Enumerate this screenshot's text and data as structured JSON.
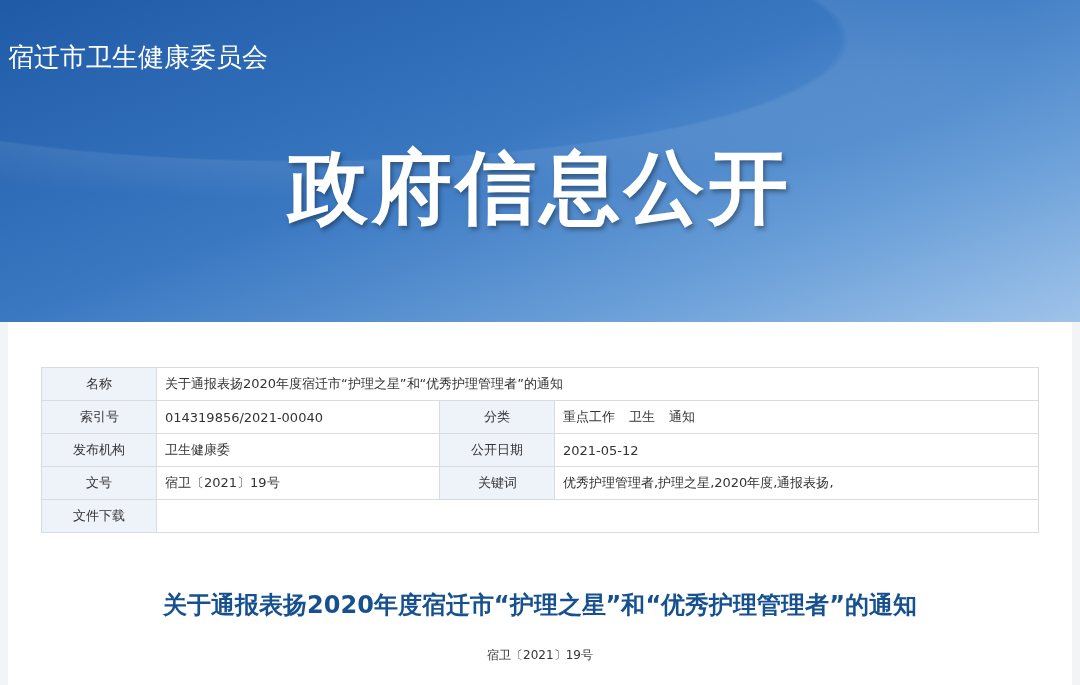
{
  "site_name": "宿迁市卫生健康委员会",
  "banner_title": "政府信息公开",
  "info_table": {
    "name_label": "名称",
    "name_value": "关于通报表扬2020年度宿迁市“护理之星”和“优秀护理管理者”的通知",
    "rows": [
      {
        "label_1": "索引号",
        "value_1": "014319856/2021-00040",
        "label_2": "分类",
        "value_2": [
          "重点工作",
          "卫生",
          "通知"
        ]
      },
      {
        "label_1": "发布机构",
        "value_1": "卫生健康委",
        "label_2": "公开日期",
        "value_2": [
          "2021-05-12"
        ]
      },
      {
        "label_1": "文号",
        "value_1": "宿卫〔2021〕19号",
        "label_2": "关键词",
        "value_2": [
          "优秀护理管理者,护理之星,2020年度,通报表扬,"
        ]
      }
    ],
    "download_label": "文件下载"
  },
  "article": {
    "title": "关于通报表扬2020年度宿迁市“护理之星”和“优秀护理管理者”的通知",
    "doc_number": "宿卫〔2021〕19号"
  }
}
